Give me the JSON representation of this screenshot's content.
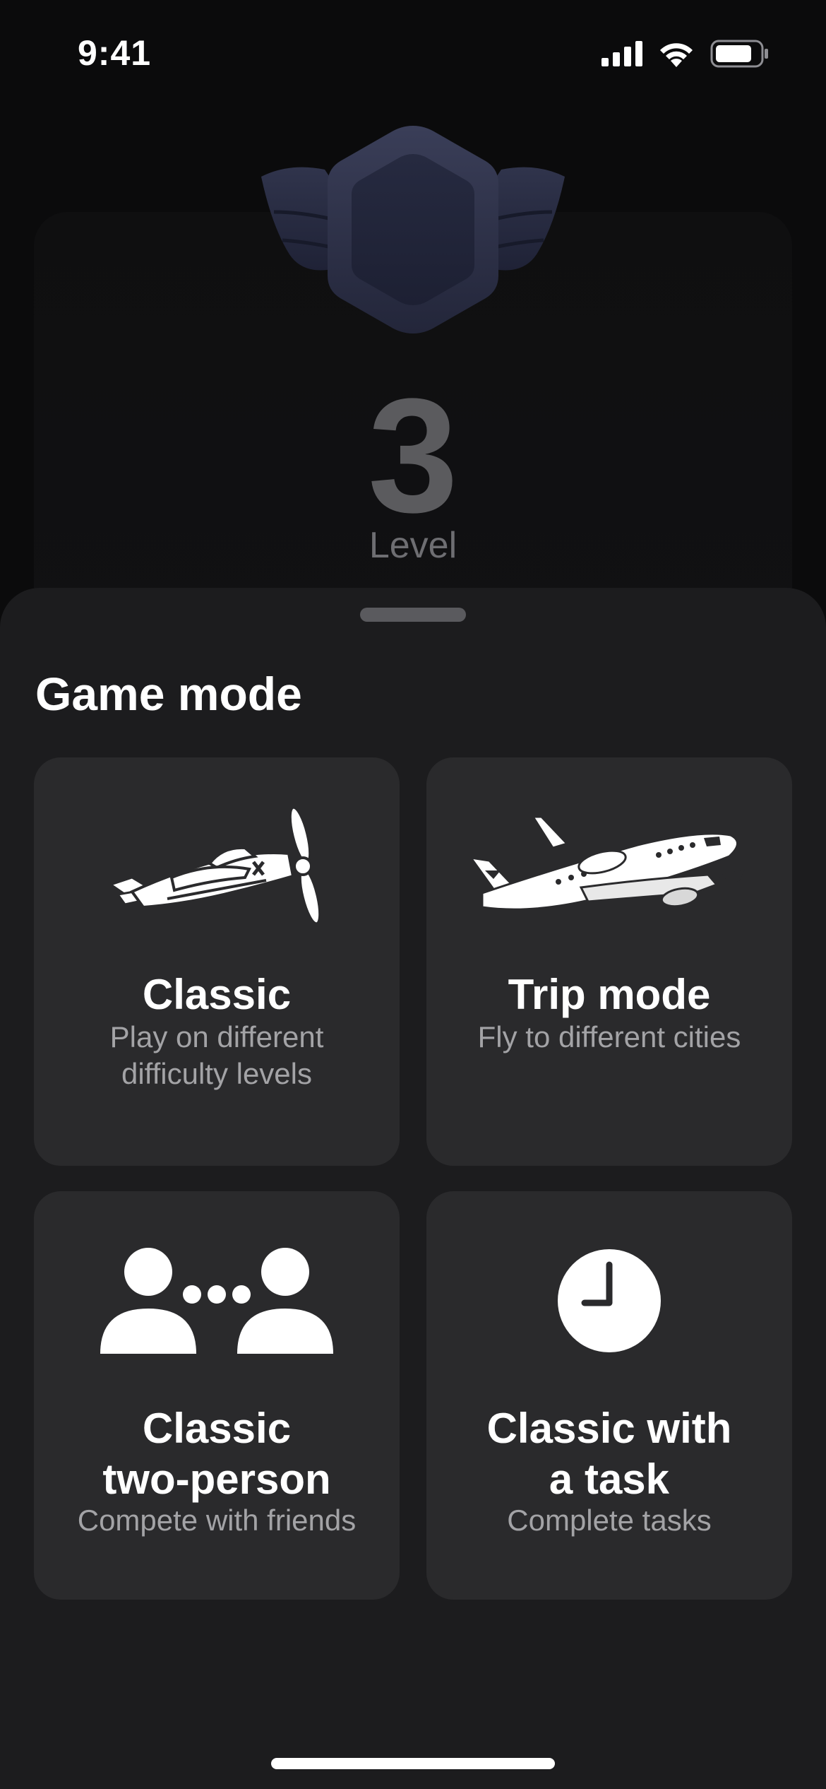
{
  "status_bar": {
    "time": "9:41"
  },
  "hero": {
    "level_number": "3",
    "level_label": "Level"
  },
  "sheet": {
    "title": "Game mode",
    "cards": [
      {
        "title": "Classic",
        "subtitle": "Play on different difficulty levels",
        "icon": "propeller-plane-icon"
      },
      {
        "title": "Trip mode",
        "subtitle": "Fly to different cities",
        "icon": "jet-plane-icon"
      },
      {
        "title": "Classic two-person",
        "subtitle": "Compete with friends",
        "icon": "two-people-icon"
      },
      {
        "title": "Classic with a task",
        "subtitle": "Complete tasks",
        "icon": "clock-icon"
      }
    ]
  },
  "colors": {
    "background": "#0b0b0c",
    "sheet": "#1c1c1e",
    "card": "#2a2a2c",
    "badge": "#2b2e44",
    "level_number": "#5b5b5e"
  }
}
